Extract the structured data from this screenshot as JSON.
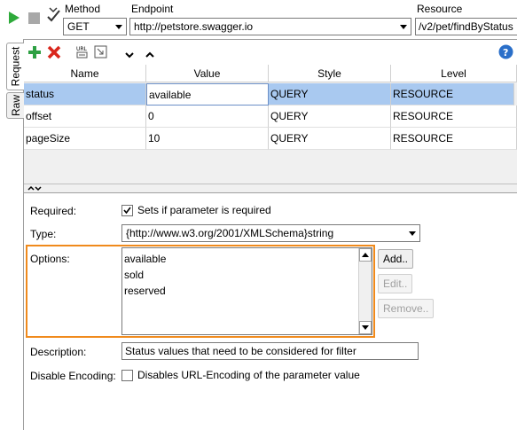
{
  "toolbar": {
    "icons": [
      "play-icon",
      "stop-icon",
      "check-options-icon"
    ],
    "method_label": "Method",
    "method_value": "GET",
    "endpoint_label": "Endpoint",
    "endpoint_value": "http://petstore.swagger.io",
    "resource_label": "Resource",
    "resource_value": "/v2/pet/findByStatus"
  },
  "tabs": [
    {
      "label": "Request",
      "active": true
    },
    {
      "label": "Raw",
      "active": false
    }
  ],
  "params_toolbar": {
    "icons": [
      "add-icon",
      "delete-icon",
      "url-icon",
      "expand-icon",
      "chevron-down-icon",
      "chevron-up-icon",
      "help-icon"
    ]
  },
  "table": {
    "columns": [
      "Name",
      "Value",
      "Style",
      "Level"
    ],
    "rows": [
      {
        "name": "status",
        "value": "available",
        "style": "QUERY",
        "level": "RESOURCE",
        "selected": true
      },
      {
        "name": "offset",
        "value": "0",
        "style": "QUERY",
        "level": "RESOURCE",
        "selected": false
      },
      {
        "name": "pageSize",
        "value": "10",
        "style": "QUERY",
        "level": "RESOURCE",
        "selected": false
      }
    ]
  },
  "detail": {
    "required_label": "Required:",
    "required_checkbox_label": "Sets if parameter is required",
    "required_checked": true,
    "type_label": "Type:",
    "type_value": "{http://www.w3.org/2001/XMLSchema}string",
    "options_label": "Options:",
    "options": [
      "available",
      "sold",
      "reserved"
    ],
    "add_button": "Add..",
    "edit_button": "Edit..",
    "remove_button": "Remove..",
    "description_label": "Description:",
    "description_value": "Status values that need to be considered for filter",
    "disable_encoding_label": "Disable Encoding:",
    "disable_encoding_checkbox_label": "Disables URL-Encoding of the parameter value",
    "disable_encoding_checked": false
  },
  "colors": {
    "highlight": "#f08a1c",
    "selection": "#a9c9f0",
    "play_green": "#2eaa3a",
    "add_green": "#2ea043",
    "delete_red": "#d9261c",
    "help_blue": "#2a6fc9"
  }
}
